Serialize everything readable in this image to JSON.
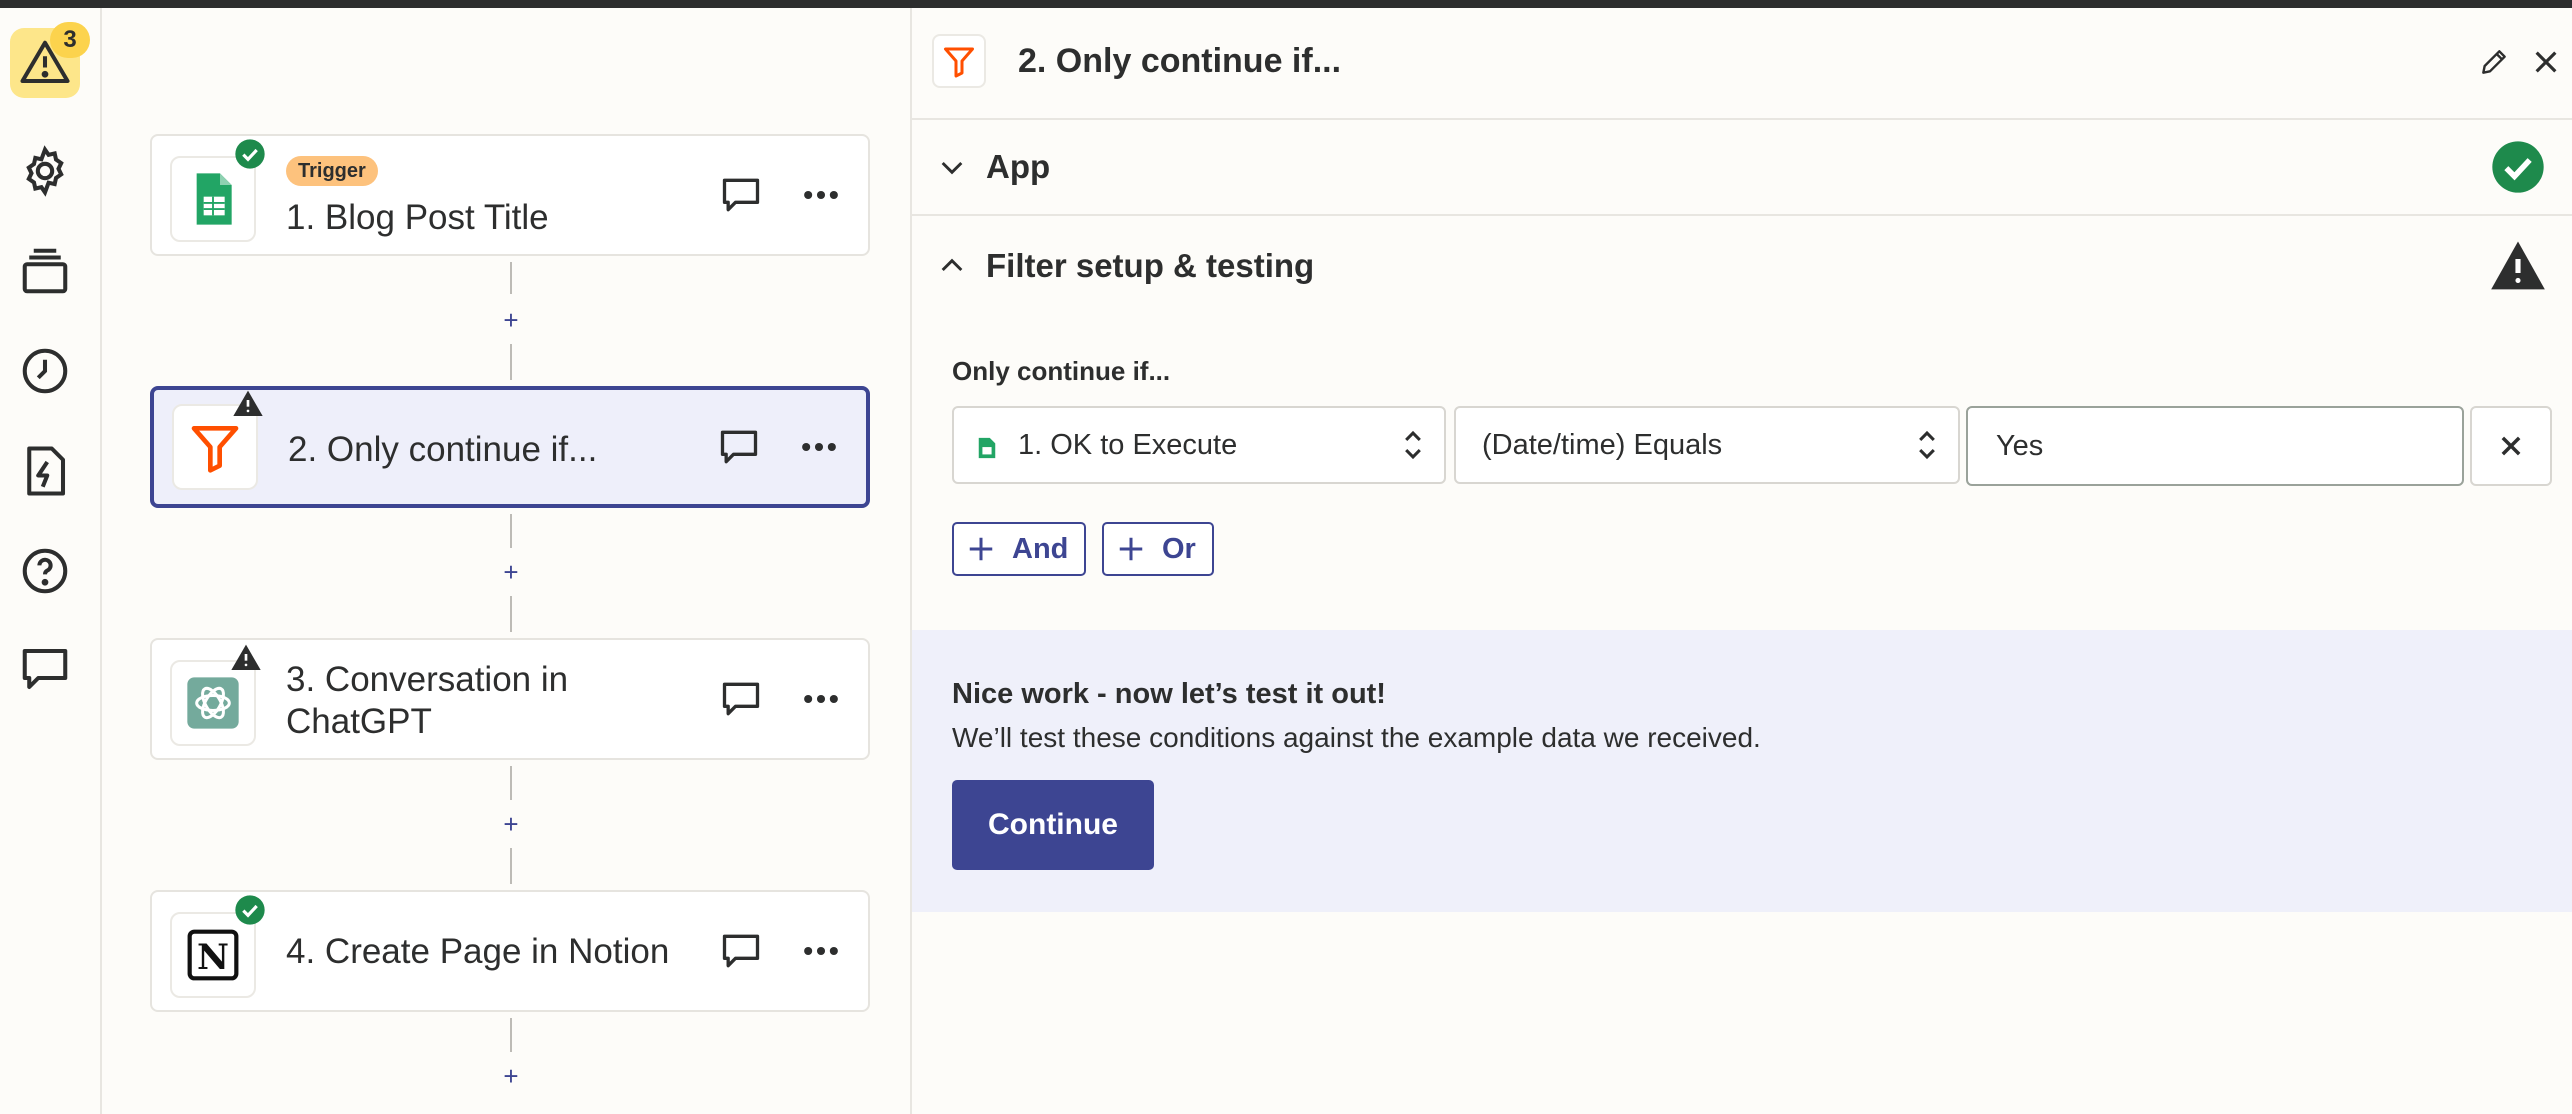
{
  "sidebar": {
    "alert_count": "3",
    "items": [
      {
        "icon": "warning-icon"
      },
      {
        "icon": "gear-icon"
      },
      {
        "icon": "versions-icon"
      },
      {
        "icon": "history-icon"
      },
      {
        "icon": "zap-runs-icon"
      },
      {
        "icon": "help-icon"
      },
      {
        "icon": "comment-icon"
      }
    ]
  },
  "steps": [
    {
      "tag": "Trigger",
      "title": "1. Blog Post Title",
      "app": "google-sheets",
      "status": "ok"
    },
    {
      "title": "2. Only continue if...",
      "app": "filter",
      "status": "warning",
      "selected": true
    },
    {
      "title_line1": "3. Conversation in",
      "title_line2": "ChatGPT",
      "app": "chatgpt",
      "status": "warning"
    },
    {
      "title": "4. Create Page in Notion",
      "app": "notion",
      "status": "ok"
    }
  ],
  "panel": {
    "title": "2. Only continue if...",
    "sections": {
      "app": {
        "title": "App",
        "status": "ok"
      },
      "filter": {
        "title": "Filter setup & testing",
        "status": "warning"
      }
    },
    "filter": {
      "label": "Only continue if...",
      "field": "1. OK to Execute",
      "condition": "(Date/time) Equals",
      "value": "Yes",
      "and_label": "And",
      "or_label": "Or"
    },
    "test": {
      "title": "Nice work - now let’s test it out!",
      "description": "We’ll test these conditions against the example data we received.",
      "button": "Continue"
    }
  },
  "colors": {
    "accent": "#3d4592",
    "success": "#1e8a4c",
    "warning_badge": "#fcd34d",
    "filter_orange": "#ff4f00"
  }
}
